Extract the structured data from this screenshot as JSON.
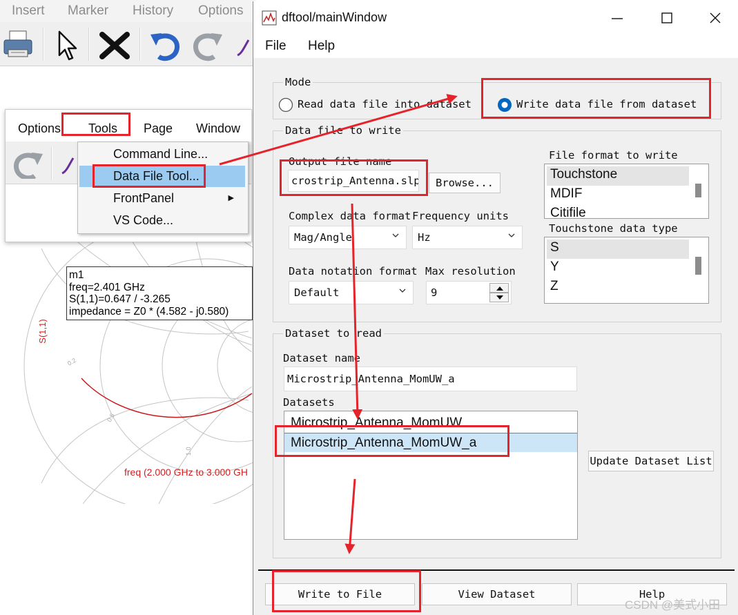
{
  "background_app": {
    "menu": [
      "Insert",
      "Marker",
      "History",
      "Options"
    ],
    "popup_menu": [
      "Options",
      "Tools",
      "Page",
      "Window"
    ],
    "tools_items": [
      {
        "label": "Command Line..."
      },
      {
        "label": "Data File Tool..."
      },
      {
        "label": "FrontPanel"
      },
      {
        "label": "VS Code..."
      }
    ],
    "marker": {
      "name": "m1",
      "freq": "freq=2.401 GHz",
      "s11": "S(1,1)=0.647 / -3.265",
      "impedance": "impedance = Z0 * (4.582 - j0.580)"
    },
    "y_label": "S(1,1)",
    "freq_range": "freq (2.000 GHz to 3.000 GH",
    "grid_labels": [
      "0.2",
      "0.5",
      "1.0"
    ]
  },
  "window": {
    "title": "dftool/mainWindow",
    "menu": [
      "File",
      "Help"
    ],
    "mode": {
      "label": "Mode",
      "read_option": "Read data file into dataset",
      "write_option": "Write data file from dataset",
      "selected": "write"
    },
    "write_group": {
      "label": "Data file to write",
      "output_label": "Output file name",
      "output_value": "crostrip_Antenna.slp",
      "browse": "Browse...",
      "complex_label": "Complex data format",
      "complex_value": "Mag/Angle",
      "freq_units_label": "Frequency units",
      "freq_units_value": "Hz",
      "notation_label": "Data notation format",
      "notation_value": "Default",
      "max_res_label": "Max resolution",
      "max_res_value": "9",
      "file_format_label": "File format to write",
      "file_formats": [
        "Touchstone",
        "MDIF",
        "Citifile"
      ],
      "ts_type_label": "Touchstone data type",
      "ts_types": [
        "S",
        "Y",
        "Z"
      ]
    },
    "dataset_group": {
      "label": "Dataset to read",
      "name_label": "Dataset name",
      "name_value": "Microstrip_Antenna_MomUW_a",
      "datasets_label": "Datasets",
      "datasets": [
        "Microstrip_Antenna_MomUW",
        "Microstrip_Antenna_MomUW_a"
      ],
      "update_button": "Update Dataset List"
    },
    "buttons": {
      "write": "Write to File",
      "view": "View Dataset",
      "help": "Help"
    }
  },
  "watermark": "CSDN @美式小田",
  "colors": {
    "annotation": "#e5232a",
    "selection": "#9ccbf1",
    "radio": "#0067c0"
  }
}
